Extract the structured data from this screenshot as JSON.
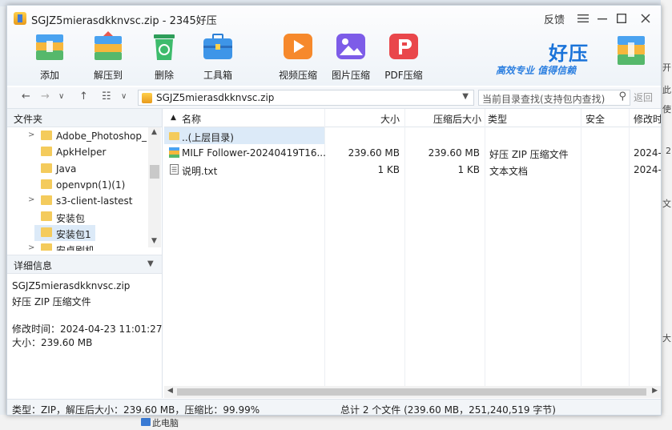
{
  "window": {
    "title": "SGJZ5mierasdkknvsc.zip - 2345好压",
    "feedback": "反馈",
    "bg_title": "SGJZ5mierasdkknvsc.zip"
  },
  "toolbar": {
    "add": "添加",
    "extract": "解压到",
    "delete": "删除",
    "toolbox": "工具箱",
    "video": "视频压缩",
    "image": "图片压缩",
    "pdf": "PDF压缩"
  },
  "brand": {
    "name": "好压",
    "slogan": "高效专业  值得信赖"
  },
  "nav": {
    "path": "SGJZ5mierasdkknvsc.zip",
    "search_placeholder": "当前目录查找(支持包内查找)",
    "back": "返回"
  },
  "tree": {
    "header": "文件夹",
    "items": [
      {
        "label": "Adobe_Photoshop_",
        "expandable": true
      },
      {
        "label": "ApkHelper",
        "expandable": false
      },
      {
        "label": "Java",
        "expandable": false
      },
      {
        "label": "openvpn(1)(1)",
        "expandable": false
      },
      {
        "label": "s3-client-lastest",
        "expandable": true
      },
      {
        "label": "安装包",
        "expandable": false
      },
      {
        "label": "安装包1",
        "expandable": false,
        "selected": true
      },
      {
        "label": "安卓刷机",
        "expandable": true
      }
    ]
  },
  "details": {
    "header": "详细信息",
    "filename": "SGJZ5mierasdkknvsc.zip",
    "filetype": "好压 ZIP 压缩文件",
    "modified": "修改时间：2024-04-23 11:01:27",
    "size": "大小：239.60 MB"
  },
  "list": {
    "headers": {
      "name": "名称",
      "size": "大小",
      "packed": "压缩后大小",
      "type": "类型",
      "security": "安全",
      "modified": "修改时"
    },
    "rows": [
      {
        "name": "..(上层目录)",
        "size": "",
        "packed": "",
        "type": "",
        "modified": "",
        "icon": "folder-icon"
      },
      {
        "name": "MILF Follower-20240419T16...",
        "size": "239.60 MB",
        "packed": "239.60 MB",
        "type": "好压 ZIP 压缩文件",
        "modified": "2024-",
        "icon": "zip-icon"
      },
      {
        "name": "说明.txt",
        "size": "1 KB",
        "packed": "1 KB",
        "type": "文本文档",
        "modified": "2024-",
        "icon": "text-file-icon"
      }
    ]
  },
  "status": {
    "left": "类型：ZIP，解压后大小：239.60 MB，压缩比：99.99%",
    "right": "总计 2 个文件 (239.60 MB，251,240,519 字节)"
  },
  "background": {
    "pc_label": "此电脑",
    "right_chars": [
      "开",
      "使",
      "此",
      "文",
      "大",
      "2"
    ]
  },
  "colors": {
    "accent": "#1a73d9",
    "selection": "#dceaf8",
    "folder": "#f4cb5c"
  }
}
